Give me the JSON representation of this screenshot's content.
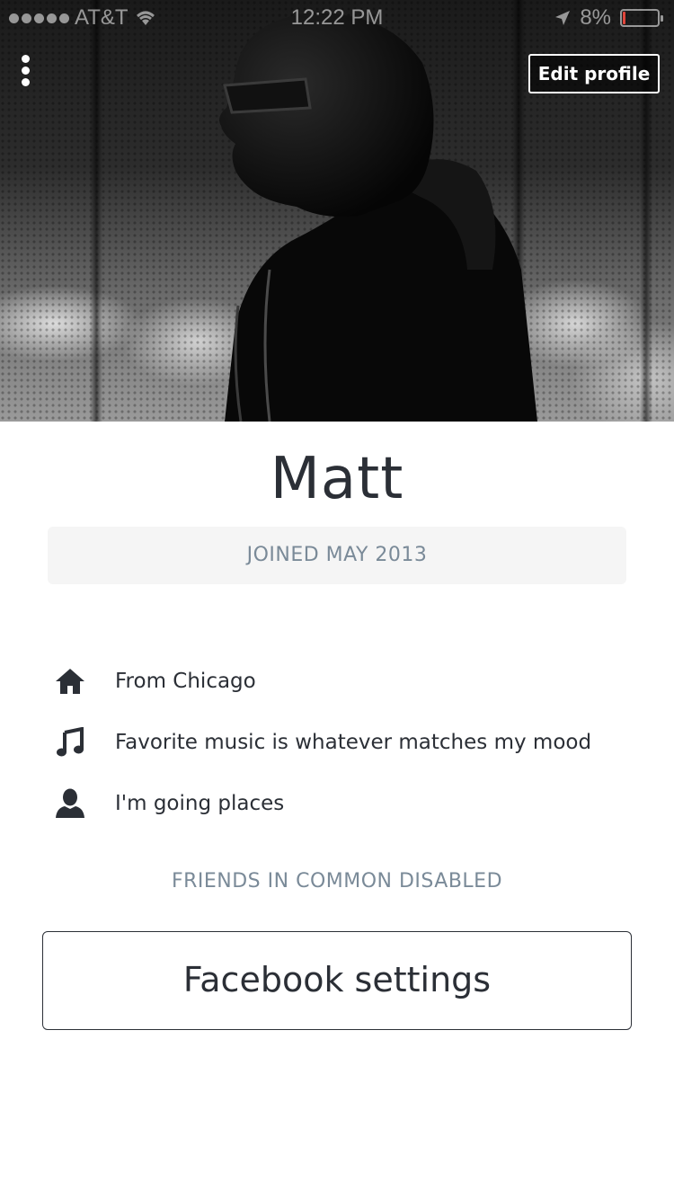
{
  "status_bar": {
    "carrier": "AT&T",
    "time": "12:22 PM",
    "battery_percent_label": "8%",
    "battery_level": 0.08,
    "icons": [
      "signal-dots-icon",
      "wifi-icon",
      "location-arrow-icon",
      "battery-icon"
    ]
  },
  "hero": {
    "menu_icon": "vertical-dots-icon",
    "edit_profile_label": "Edit profile"
  },
  "profile": {
    "name": "Matt",
    "joined": "JOINED MAY 2013",
    "details": [
      {
        "icon": "home-icon",
        "text": "From Chicago"
      },
      {
        "icon": "music-note-icon",
        "text": "Favorite music is whatever matches my mood"
      },
      {
        "icon": "person-icon",
        "text": "I'm going places"
      }
    ],
    "friends_note": "FRIENDS IN COMMON DISABLED",
    "facebook_settings_label": "Facebook settings"
  },
  "colors": {
    "text_primary": "#2b2f36",
    "text_muted": "#7a8a98",
    "badge_bg": "#f5f5f5",
    "battery_low": "#e0463b"
  }
}
